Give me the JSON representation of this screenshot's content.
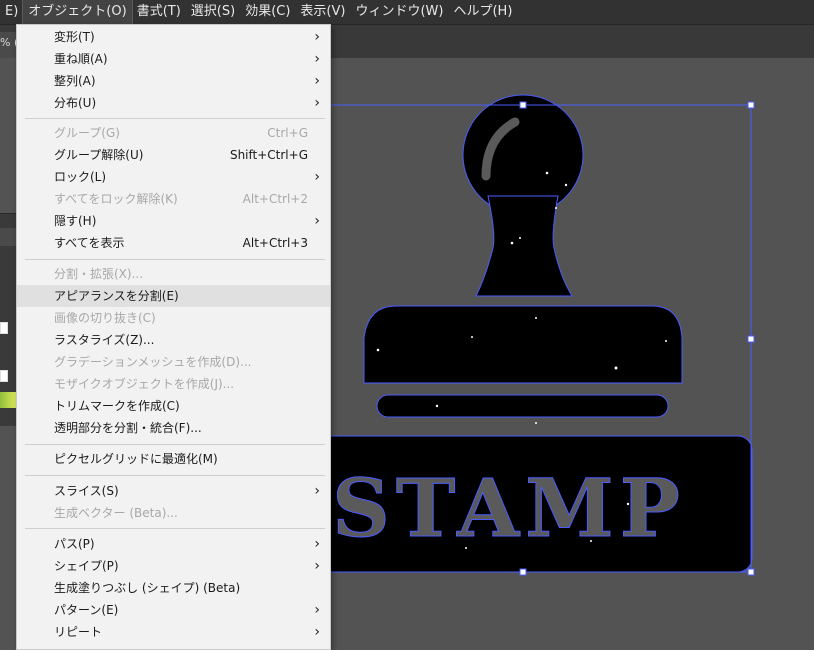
{
  "menubar": {
    "items": [
      {
        "label": "E)"
      },
      {
        "label": "オブジェクト(O)"
      },
      {
        "label": "書式(T)"
      },
      {
        "label": "選択(S)"
      },
      {
        "label": "効果(C)"
      },
      {
        "label": "表示(V)"
      },
      {
        "label": "ウィンドウ(W)"
      },
      {
        "label": "ヘルプ(H)"
      }
    ]
  },
  "document_tab": {
    "label": "% (F"
  },
  "menu": {
    "items": [
      {
        "label": "変形(T)",
        "shortcut": "",
        "submenu": true,
        "disabled": false
      },
      {
        "label": "重ね順(A)",
        "shortcut": "",
        "submenu": true,
        "disabled": false
      },
      {
        "label": "整列(A)",
        "shortcut": "",
        "submenu": true,
        "disabled": false
      },
      {
        "label": "分布(U)",
        "shortcut": "",
        "submenu": true,
        "disabled": false
      },
      {
        "label": "グループ(G)",
        "shortcut": "Ctrl+G",
        "submenu": false,
        "disabled": true
      },
      {
        "label": "グループ解除(U)",
        "shortcut": "Shift+Ctrl+G",
        "submenu": false,
        "disabled": false
      },
      {
        "label": "ロック(L)",
        "shortcut": "",
        "submenu": true,
        "disabled": false
      },
      {
        "label": "すべてをロック解除(K)",
        "shortcut": "Alt+Ctrl+2",
        "submenu": false,
        "disabled": true
      },
      {
        "label": "隠す(H)",
        "shortcut": "",
        "submenu": true,
        "disabled": false
      },
      {
        "label": "すべてを表示",
        "shortcut": "Alt+Ctrl+3",
        "submenu": false,
        "disabled": false
      },
      {
        "label": "分割・拡張(X)...",
        "shortcut": "",
        "submenu": false,
        "disabled": true
      },
      {
        "label": "アピアランスを分割(E)",
        "shortcut": "",
        "submenu": false,
        "disabled": false,
        "hover": true
      },
      {
        "label": "画像の切り抜き(C)",
        "shortcut": "",
        "submenu": false,
        "disabled": true
      },
      {
        "label": "ラスタライズ(Z)...",
        "shortcut": "",
        "submenu": false,
        "disabled": false
      },
      {
        "label": "グラデーションメッシュを作成(D)...",
        "shortcut": "",
        "submenu": false,
        "disabled": true
      },
      {
        "label": "モザイクオブジェクトを作成(J)...",
        "shortcut": "",
        "submenu": false,
        "disabled": true
      },
      {
        "label": "トリムマークを作成(C)",
        "shortcut": "",
        "submenu": false,
        "disabled": false
      },
      {
        "label": "透明部分を分割・統合(F)...",
        "shortcut": "",
        "submenu": false,
        "disabled": false
      },
      {
        "label": "ピクセルグリッドに最適化(M)",
        "shortcut": "",
        "submenu": false,
        "disabled": false
      },
      {
        "label": "スライス(S)",
        "shortcut": "",
        "submenu": true,
        "disabled": false
      },
      {
        "label": "生成ベクター (Beta)...",
        "shortcut": "",
        "submenu": false,
        "disabled": true
      },
      {
        "label": "パス(P)",
        "shortcut": "",
        "submenu": true,
        "disabled": false
      },
      {
        "label": "シェイプ(P)",
        "shortcut": "",
        "submenu": true,
        "disabled": false
      },
      {
        "label": "生成塗りつぶし (シェイプ) (Beta)",
        "shortcut": "",
        "submenu": false,
        "disabled": false
      },
      {
        "label": "パターン(E)",
        "shortcut": "",
        "submenu": true,
        "disabled": false
      },
      {
        "label": "リピート",
        "shortcut": "",
        "submenu": true,
        "disabled": false
      }
    ]
  },
  "artwork": {
    "stamp_text": "STAMP",
    "fill_color": "#000000",
    "selection_color": "#4a5cff",
    "text_color": "#5a5a5a"
  }
}
